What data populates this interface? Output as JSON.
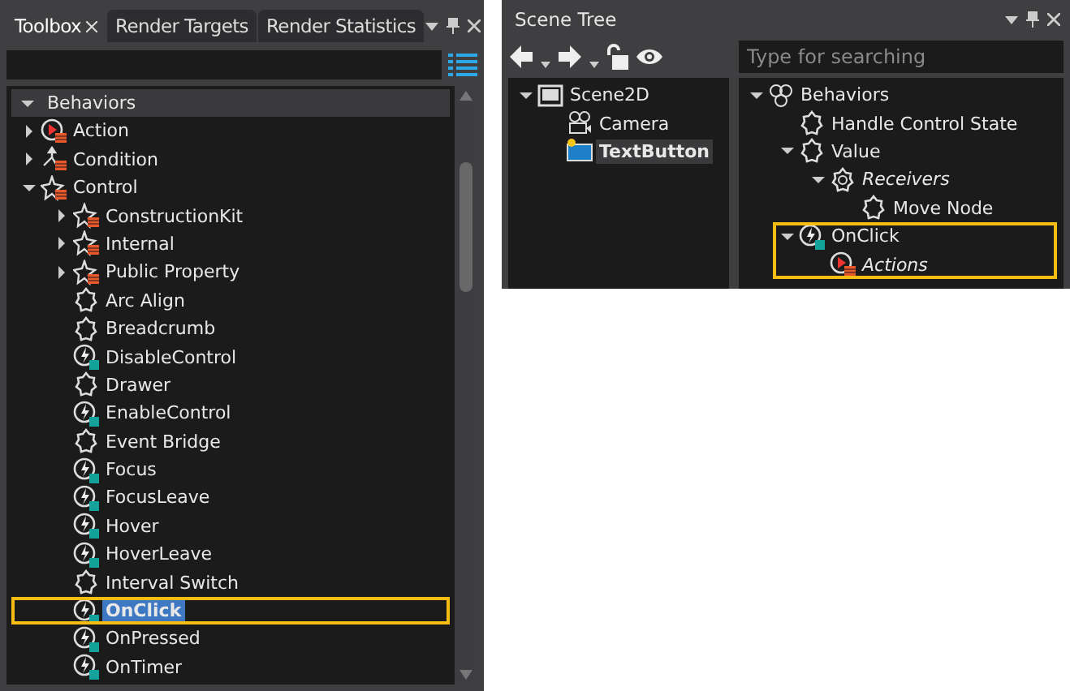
{
  "toolbox": {
    "tabs": [
      {
        "label": "Toolbox",
        "selected": true,
        "closable": true
      },
      {
        "label": "Render Targets",
        "selected": false
      },
      {
        "label": "Render Statistics",
        "selected": false
      }
    ],
    "category": {
      "label": "Behaviors",
      "expanded": true
    },
    "items": [
      {
        "label": "Action",
        "kind": "action",
        "expanded": false,
        "selected": false
      },
      {
        "label": "Condition",
        "kind": "condition",
        "expanded": false,
        "selected": false
      },
      {
        "label": "Control",
        "kind": "control",
        "expanded": true,
        "selected": false,
        "children": [
          {
            "label": "ConstructionKit",
            "kind": "control",
            "expanded": false,
            "selected": false
          },
          {
            "label": "Internal",
            "kind": "control",
            "expanded": false,
            "selected": false
          },
          {
            "label": "Public Property",
            "kind": "control",
            "expanded": false,
            "selected": false
          },
          {
            "label": "Arc Align",
            "kind": "behavior",
            "selected": false
          },
          {
            "label": "Breadcrumb",
            "kind": "behavior",
            "selected": false
          },
          {
            "label": "DisableControl",
            "kind": "trigger",
            "selected": false
          },
          {
            "label": "Drawer",
            "kind": "behavior",
            "selected": false
          },
          {
            "label": "EnableControl",
            "kind": "trigger",
            "selected": false
          },
          {
            "label": "Event Bridge",
            "kind": "behavior",
            "selected": false
          },
          {
            "label": "Focus",
            "kind": "trigger",
            "selected": false
          },
          {
            "label": "FocusLeave",
            "kind": "trigger",
            "selected": false
          },
          {
            "label": "Hover",
            "kind": "trigger",
            "selected": false
          },
          {
            "label": "HoverLeave",
            "kind": "trigger",
            "selected": false
          },
          {
            "label": "Interval Switch",
            "kind": "behavior",
            "selected": false
          },
          {
            "label": "OnClick",
            "kind": "trigger",
            "highlighted": true,
            "selected": true
          },
          {
            "label": "OnPressed",
            "kind": "trigger",
            "selected": false
          },
          {
            "label": "OnTimer",
            "kind": "trigger",
            "selected": false
          }
        ]
      }
    ]
  },
  "scene_tree": {
    "title": "Scene Tree",
    "search": {
      "placeholder": "Type for searching"
    },
    "nodes": [
      {
        "label": "Scene2D",
        "kind": "scene",
        "expanded": true,
        "selected": false,
        "children": [
          {
            "label": "Camera",
            "kind": "camera",
            "selected": false
          },
          {
            "label": "TextButton",
            "kind": "textbutton",
            "selected": true
          }
        ]
      }
    ],
    "behaviors": [
      {
        "label": "Behaviors",
        "kind": "group",
        "expanded": true,
        "italic": false,
        "children": [
          {
            "label": "Handle Control State",
            "kind": "behavior",
            "italic": false
          },
          {
            "label": "Value",
            "kind": "behavior",
            "expanded": true,
            "italic": false,
            "children": [
              {
                "label": "Receivers",
                "kind": "property",
                "expanded": true,
                "italic": true,
                "children": [
                  {
                    "label": "Move Node",
                    "kind": "behavior",
                    "italic": false
                  }
                ]
              }
            ]
          },
          {
            "label": "OnClick",
            "kind": "trigger",
            "expanded": true,
            "italic": false,
            "highlighted": true,
            "children": [
              {
                "label": "Actions",
                "kind": "action",
                "italic": true
              }
            ]
          }
        ]
      }
    ]
  }
}
